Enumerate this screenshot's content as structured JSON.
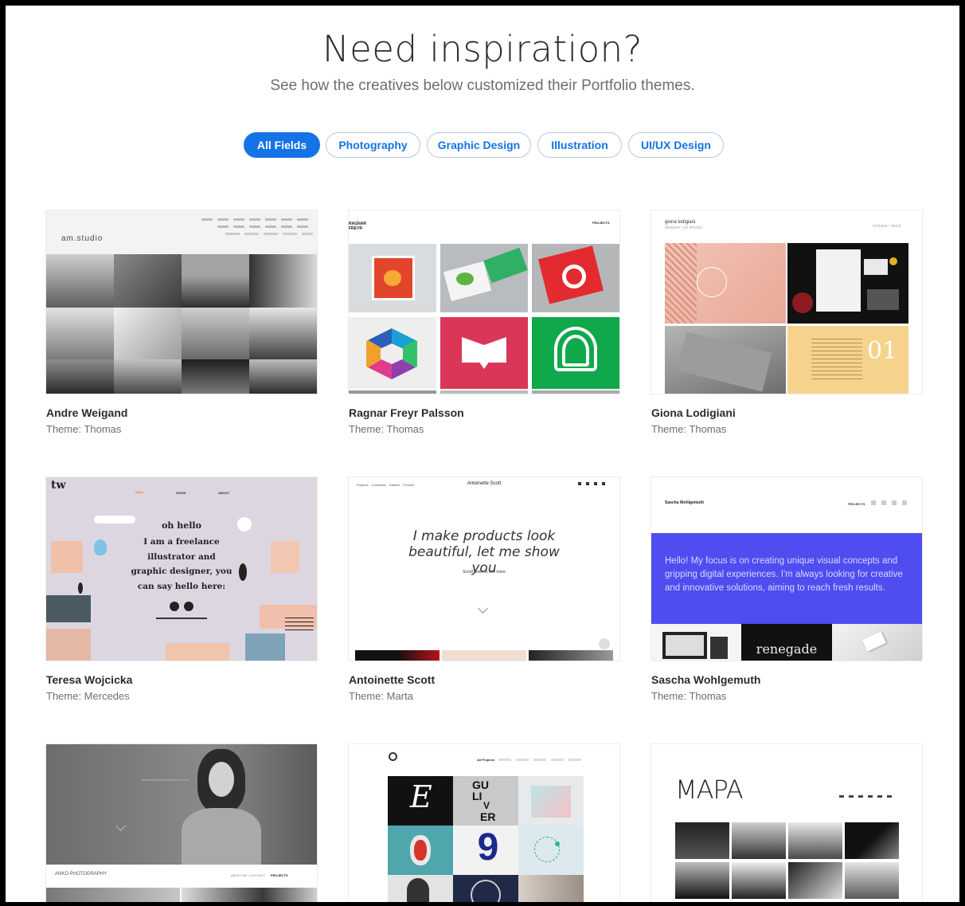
{
  "hero": {
    "title": "Need inspiration?",
    "subtitle": "See how the creatives below customized their Portfolio themes."
  },
  "filters": [
    {
      "label": "All Fields",
      "active": true
    },
    {
      "label": "Photography",
      "active": false
    },
    {
      "label": "Graphic Design",
      "active": false
    },
    {
      "label": "Illustration",
      "active": false
    },
    {
      "label": "UI/UX Design",
      "active": false
    }
  ],
  "cards": [
    {
      "name": "Andre Weigand",
      "theme": "Theme: Thomas",
      "preview": {
        "logo": "am.studio"
      }
    },
    {
      "name": "Ragnar Freyr Palsson",
      "theme": "Theme: Thomas",
      "preview": {
        "logo": "RAGNAR FREYR",
        "nav": "PROJECTS"
      }
    },
    {
      "name": "Giona Lodigiani",
      "theme": "Theme: Thomas",
      "preview": {
        "logo": "giona lodigiani",
        "tagline": "designer / art director",
        "nav": "contacts / about",
        "tile_number": "01"
      }
    },
    {
      "name": "Teresa Wojcicka",
      "theme": "Theme: Mercedes",
      "preview": {
        "logo": "tw",
        "nav": [
          "WORK",
          "ABOUT"
        ],
        "greeting": "oh hello",
        "intro": "I am a freelance illustrator and graphic designer, you can say hello here:"
      }
    },
    {
      "name": "Antoinette Scott",
      "theme": "Theme: Marta",
      "preview": {
        "logo": "Antoinette Scott",
        "nav": [
          "Projects",
          "Cosmetics",
          "Edibles",
          "Product"
        ],
        "headline": "I make products look beautiful, let me show you",
        "scroll": "Scroll down to see more"
      }
    },
    {
      "name": "Sascha Wohlgemuth",
      "theme": "Theme: Thomas",
      "preview": {
        "logo": "Sascha Wohlgemuth",
        "nav": "PROJECTS",
        "intro": "Hello! My focus is on creating unique visual concepts and gripping digital experiences. I'm always looking for creative and innovative solutions, aiming to reach fresh results.",
        "tile_word": "renegade"
      }
    },
    {
      "name": "",
      "theme": "",
      "preview": {
        "logo": "ANKO PHOTOGRAPHY",
        "nav": [
          "ABOUT ME / CONTACT",
          "PROJECTS"
        ]
      }
    },
    {
      "name": "",
      "theme": "",
      "preview": {
        "nav": "All Projects",
        "tile_letter": "E",
        "tile_number": "9",
        "tile_words": [
          "GU",
          "LI",
          "V",
          "ER"
        ]
      }
    },
    {
      "name": "",
      "theme": "",
      "preview": {
        "logo": "MAPA"
      }
    }
  ],
  "colors": {
    "accent": "#1473e6",
    "sascha_blue": "#4f4cf0",
    "teresa_bg": "#dcd6e1"
  }
}
